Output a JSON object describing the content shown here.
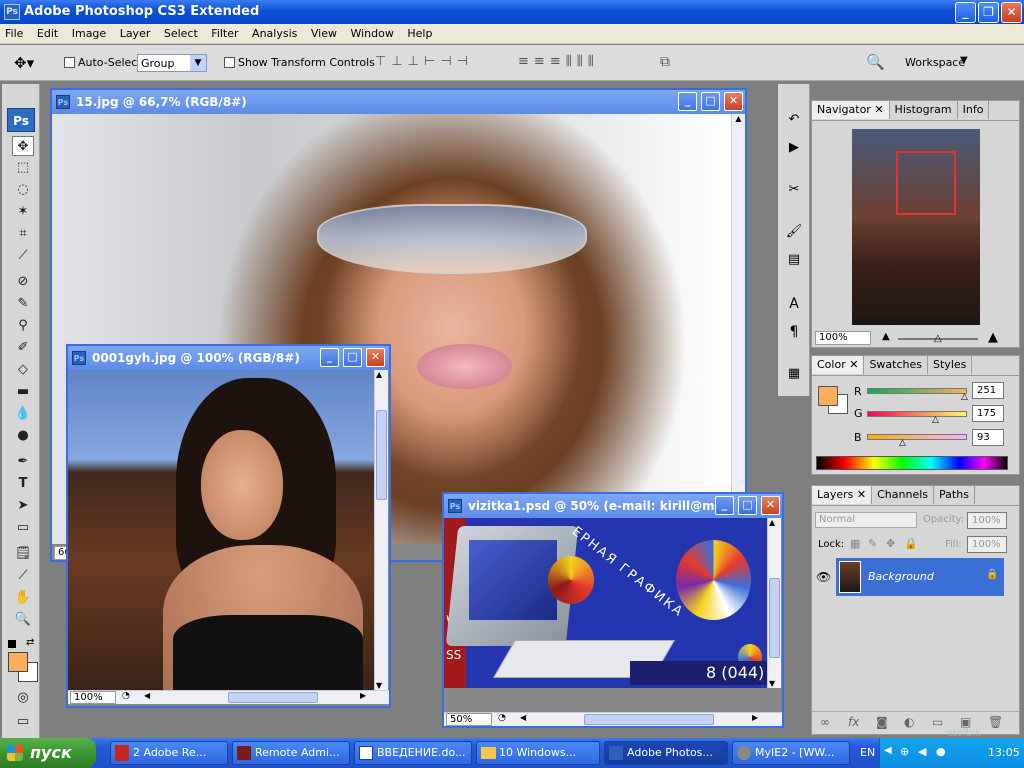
{
  "app": {
    "title": "Adobe Photoshop CS3 Extended",
    "icon": "ps-icon"
  },
  "menu": [
    "File",
    "Edit",
    "Image",
    "Layer",
    "Select",
    "Filter",
    "Analysis",
    "View",
    "Window",
    "Help"
  ],
  "options": {
    "auto_select_label": "Auto-Select:",
    "auto_select_value": "Group",
    "show_transform_label": "Show Transform Controls",
    "workspace_label": "Workspace"
  },
  "documents": {
    "doc1": {
      "title": "15.jpg @ 66,7% (RGB/8#)",
      "zoom": "66"
    },
    "doc2": {
      "title": "0001gyh.jpg @ 100% (RGB/8#)",
      "zoom": "100%"
    },
    "doc3": {
      "title": "vizitka1.psd @ 50% (e-mail: kirill@m...",
      "zoom": "50%",
      "art_text_1": "ЕРНАЯ ГРАФИКА",
      "art_text_2": "8 (044)",
      "art_side_1": "W",
      "art_side_2": "SS"
    }
  },
  "navigator": {
    "tabs": [
      "Navigator",
      "Histogram",
      "Info"
    ],
    "zoom": "100%"
  },
  "color": {
    "tabs": [
      "Color",
      "Swatches",
      "Styles"
    ],
    "r_label": "R",
    "g_label": "G",
    "b_label": "B",
    "r": "251",
    "g": "175",
    "b": "93",
    "fg_color": "#fbaf5d"
  },
  "layers": {
    "tabs": [
      "Layers",
      "Channels",
      "Paths"
    ],
    "blend": "Normal",
    "opacity_label": "Opacity:",
    "opacity": "100%",
    "lock_label": "Lock:",
    "fill_label": "Fill:",
    "fill": "100%",
    "layer_name": "Background"
  },
  "taskbar": {
    "start": "пуск",
    "items": [
      "2 Adobe Re...",
      "Remote Admi...",
      "ВВЕДЕНИЕ.do...",
      "10 Windows...",
      "Adobe Photos...",
      "MyIE2 - [WW..."
    ],
    "lang": "EN",
    "clock": "13:05",
    "watermark": "stolbik"
  },
  "colors": {
    "accent": "#0a4fd6",
    "doc_title": "#5c8be9",
    "selection": "#3b6fd4"
  }
}
